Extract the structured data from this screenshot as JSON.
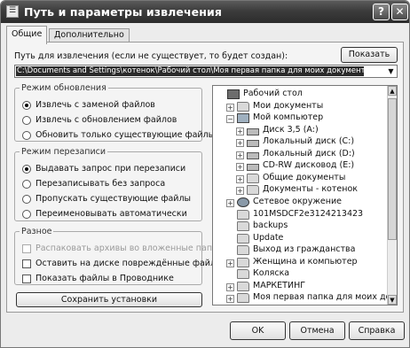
{
  "window": {
    "title": "Путь и параметры извлечения",
    "icon": "archive-window-icon",
    "help_glyph": "?",
    "close_glyph": "✕"
  },
  "tabs": [
    {
      "label": "Общие",
      "active": true
    },
    {
      "label": "Дополнительно",
      "active": false
    }
  ],
  "path": {
    "label": "Путь для извлечения (если не существует, то будет создан):",
    "show_button": "Показать",
    "value": "C:\\Documents and Settings\\котенок\\Рабочий стол\\Моя первая папка для моих документов"
  },
  "update_mode": {
    "title": "Режим обновления",
    "options": [
      {
        "label": "Извлечь с заменой файлов",
        "selected": true
      },
      {
        "label": "Извлечь с обновлением файлов",
        "selected": false
      },
      {
        "label": "Обновить только существующие файлы",
        "selected": false
      }
    ]
  },
  "overwrite_mode": {
    "title": "Режим перезаписи",
    "options": [
      {
        "label": "Выдавать запрос при перезаписи",
        "selected": true
      },
      {
        "label": "Перезаписывать без запроса",
        "selected": false
      },
      {
        "label": "Пропускать существующие файлы",
        "selected": false
      },
      {
        "label": "Переименовывать автоматически",
        "selected": false
      }
    ]
  },
  "misc": {
    "title": "Разное",
    "options": [
      {
        "label": "Распаковать архивы во вложенные папки",
        "checked": false,
        "disabled": true
      },
      {
        "label": "Оставить на диске повреждённые файлы",
        "checked": false,
        "disabled": false
      },
      {
        "label": "Показать файлы в Проводнике",
        "checked": false,
        "disabled": false
      }
    ]
  },
  "save_button": "Сохранить установки",
  "tree": [
    {
      "label": "Рабочий стол",
      "icon": "desktop-icon",
      "expander": ""
    },
    {
      "label": "Мои документы",
      "icon": "folder-icon",
      "expander": "+"
    },
    {
      "label": "Мой компьютер",
      "icon": "computer-icon",
      "expander": "−"
    },
    {
      "label": "Диск 3,5 (A:)",
      "icon": "floppy-drive-icon",
      "expander": "+"
    },
    {
      "label": "Локальный диск (C:)",
      "icon": "hard-drive-icon",
      "expander": "+"
    },
    {
      "label": "Локальный диск (D:)",
      "icon": "hard-drive-icon",
      "expander": "+"
    },
    {
      "label": "CD-RW дисковод (E:)",
      "icon": "cd-drive-icon",
      "expander": "+"
    },
    {
      "label": "Общие документы",
      "icon": "folder-icon",
      "expander": "+"
    },
    {
      "label": "Документы - котенок",
      "icon": "folder-icon",
      "expander": "+"
    },
    {
      "label": "Сетевое окружение",
      "icon": "network-icon",
      "expander": "+"
    },
    {
      "label": "101MSDCF2e3124213423",
      "icon": "folder-icon",
      "expander": ""
    },
    {
      "label": "backups",
      "icon": "folder-icon",
      "expander": ""
    },
    {
      "label": "Update",
      "icon": "folder-icon",
      "expander": ""
    },
    {
      "label": "Выход из гражданства",
      "icon": "folder-icon",
      "expander": ""
    },
    {
      "label": "Женщина и компьютер",
      "icon": "folder-icon",
      "expander": "+"
    },
    {
      "label": "Коляска",
      "icon": "folder-icon",
      "expander": ""
    },
    {
      "label": "МАРКЕТИНГ",
      "icon": "folder-icon",
      "expander": "+"
    },
    {
      "label": "Моя первая папка для моих документов",
      "icon": "folder-icon",
      "expander": "+"
    }
  ],
  "buttons": {
    "ok": "OK",
    "cancel": "Отмена",
    "help": "Справка"
  }
}
